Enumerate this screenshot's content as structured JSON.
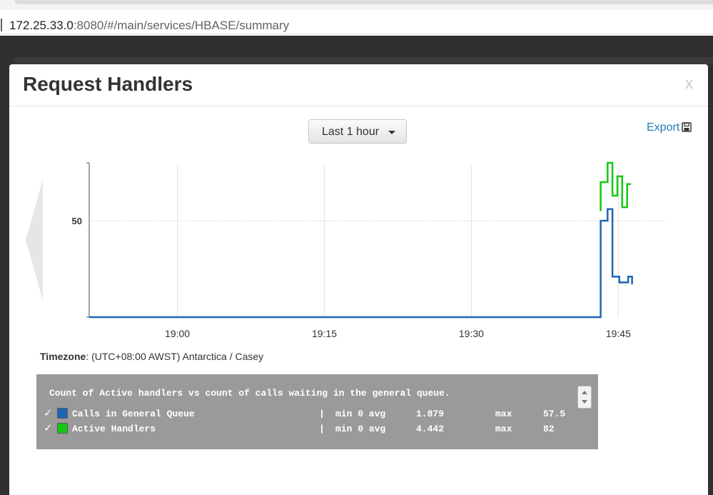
{
  "browser": {
    "url_host": "172.25.33.0",
    "url_rest": ":8080/#/main/services/HBASE/summary"
  },
  "modal": {
    "title": "Request Handlers",
    "close_label": "x",
    "time_range": "Last 1 hour",
    "export_label": "Export",
    "timezone_label": "Timezone",
    "timezone_value": ": (UTC+08:00 AWST) Antarctica / Casey"
  },
  "legend": {
    "title": "Count of Active handlers vs count of calls waiting in the general queue.",
    "rows": [
      {
        "check": "✓",
        "name": "Calls in General Queue",
        "pipe": "|",
        "min_label": "min 0 avg",
        "avg": "1.879",
        "max_label": "max",
        "max": "57.5",
        "color": "#1c66b3"
      },
      {
        "check": "✓",
        "name": "Active Handlers",
        "pipe": "|",
        "min_label": "min 0 avg",
        "avg": "4.442",
        "max_label": "max",
        "max": "82",
        "color": "#14c814"
      }
    ]
  },
  "chart_data": {
    "type": "line",
    "x_ticks": [
      "19:00",
      "19:15",
      "19:30",
      "19:45"
    ],
    "y_ticks": [
      "50"
    ],
    "xlim": [
      "18:51",
      "19:50"
    ],
    "ylim": [
      0,
      80
    ],
    "grid": true,
    "series": [
      {
        "name": "Active Handlers",
        "color": "#14c814",
        "points": [
          [
            "19:43.2",
            55
          ],
          [
            "19:43.2",
            70
          ],
          [
            "19:43.9",
            70
          ],
          [
            "19:43.9",
            80
          ],
          [
            "19:44.4",
            80
          ],
          [
            "19:44.4",
            63
          ],
          [
            "19:44.9",
            63
          ],
          [
            "19:44.9",
            73
          ],
          [
            "19:45.4",
            73
          ],
          [
            "19:45.4",
            57
          ],
          [
            "19:45.9",
            57
          ],
          [
            "19:45.9",
            69
          ],
          [
            "19:46.3",
            69
          ]
        ]
      },
      {
        "name": "Calls in General Queue",
        "color": "#1c66b3",
        "points": [
          [
            "18:51",
            0
          ],
          [
            "19:43.2",
            0
          ],
          [
            "19:43.2",
            50
          ],
          [
            "19:43.9",
            50
          ],
          [
            "19:43.9",
            56
          ],
          [
            "19:44.4",
            56
          ],
          [
            "19:44.4",
            21
          ],
          [
            "19:45.1",
            21
          ],
          [
            "19:45.1",
            18
          ],
          [
            "19:46.0",
            18
          ],
          [
            "19:46.0",
            21
          ],
          [
            "19:46.4",
            21
          ],
          [
            "19:46.4",
            17
          ]
        ]
      }
    ]
  }
}
